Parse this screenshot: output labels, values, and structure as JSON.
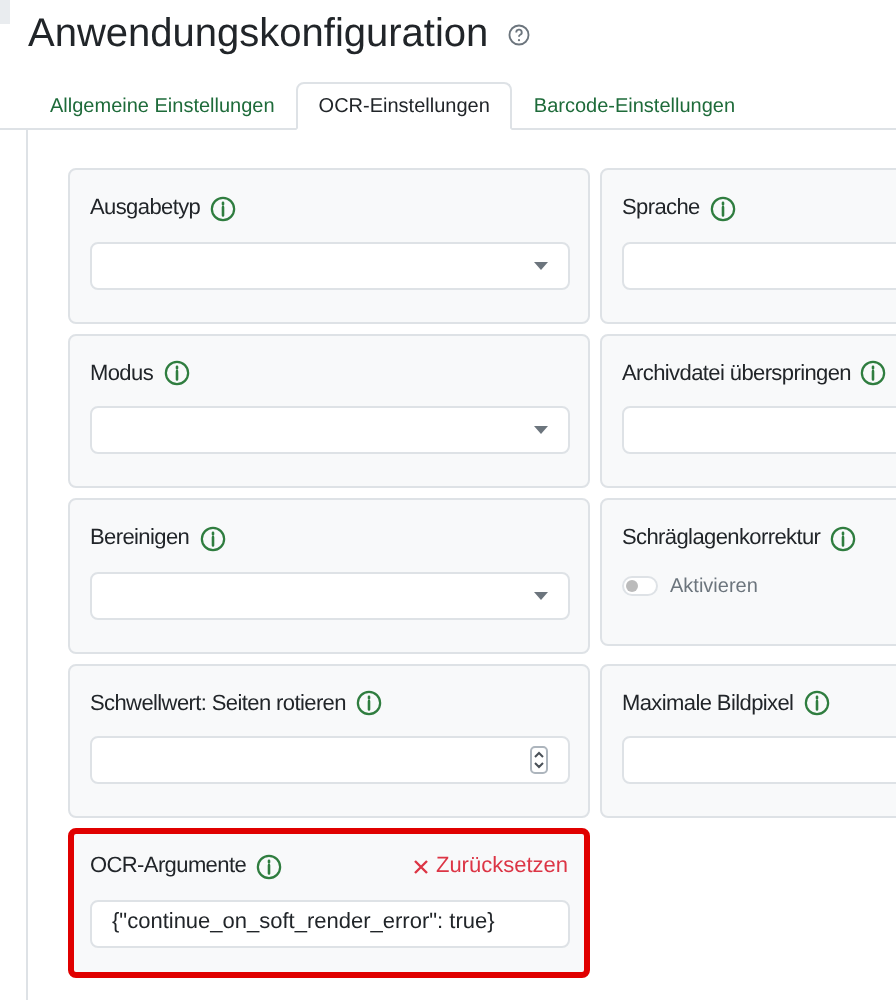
{
  "title": "Anwendungskonfiguration",
  "tabs": [
    {
      "label": "Allgemeine Einstellungen",
      "selected": false
    },
    {
      "label": "OCR-Einstellungen",
      "selected": true
    },
    {
      "label": "Barcode-Einstellungen",
      "selected": false
    }
  ],
  "fields": [
    {
      "label": "Ausgabetyp",
      "kind": "select"
    },
    {
      "label": "Sprache",
      "kind": "text"
    },
    {
      "label": "Modus",
      "kind": "select"
    },
    {
      "label": "Archivdatei überspringen",
      "kind": "text"
    },
    {
      "label": "Bereinigen",
      "kind": "select"
    },
    {
      "label": "Schräglagenkorrektur",
      "kind": "toggle",
      "on": false,
      "toggle_label": "Aktivieren"
    },
    {
      "label": "Schwellwert: Seiten rotieren",
      "kind": "number"
    },
    {
      "label": "Maximale Bildpixel",
      "kind": "text"
    },
    {
      "label": "OCR-Argumente",
      "kind": "text",
      "value": "{\"continue_on_soft_render_error\": true}",
      "highlighted": true,
      "reset_label": "Zurücksetzen"
    }
  ]
}
